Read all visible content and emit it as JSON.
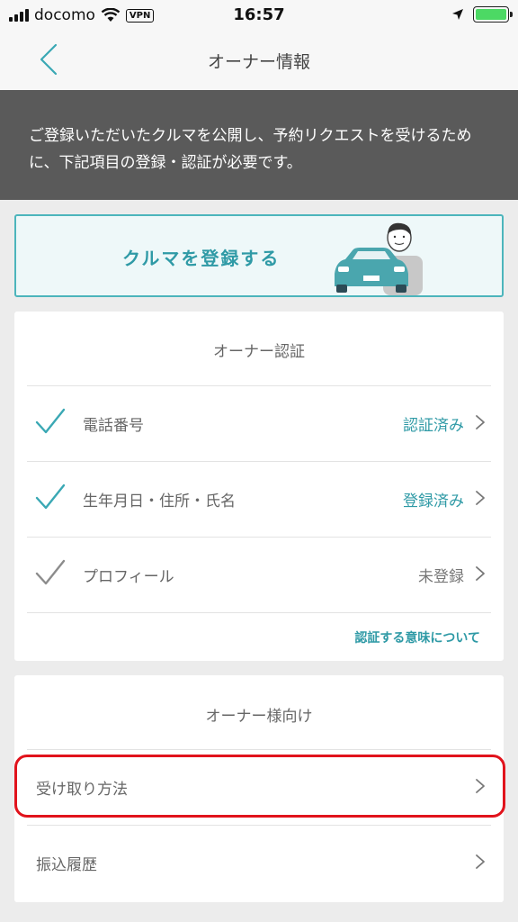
{
  "status_bar": {
    "carrier": "docomo",
    "vpn": "VPN",
    "time": "16:57"
  },
  "nav": {
    "title": "オーナー情報"
  },
  "banner": {
    "text": "ご登録いただいたクルマを公開し、予約リクエストを受けるために、下記項目の登録・認証が必要です。"
  },
  "register_car": {
    "label": "クルマを登録する"
  },
  "owner_auth": {
    "title": "オーナー認証",
    "items": [
      {
        "label": "電話番号",
        "status": "認証済み",
        "checked": true
      },
      {
        "label": "生年月日・住所・氏名",
        "status": "登録済み",
        "checked": true
      },
      {
        "label": "プロフィール",
        "status": "未登録",
        "checked": false
      }
    ],
    "about_link": "認証する意味について"
  },
  "owner_menu": {
    "title": "オーナー様向け",
    "items": [
      {
        "label": "受け取り方法"
      },
      {
        "label": "振込履歴"
      }
    ]
  },
  "colors": {
    "accent": "#2f9aa6",
    "banner_bg": "#5a5a5a",
    "highlight": "#e1131c",
    "unchecked": "#8c8c8c"
  }
}
